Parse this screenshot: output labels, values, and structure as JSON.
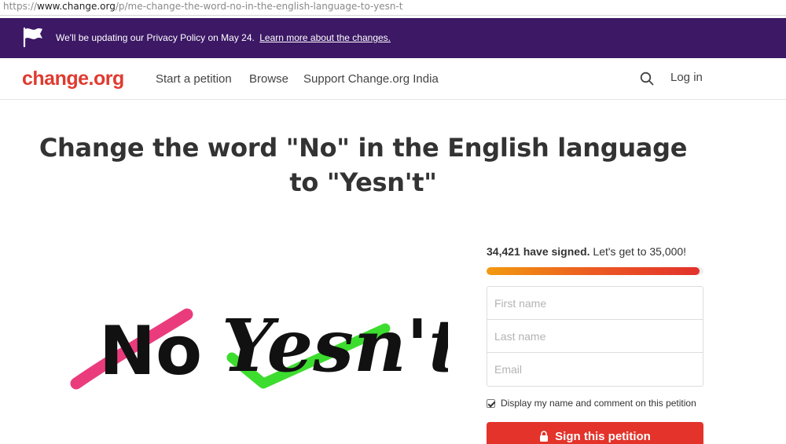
{
  "address_bar": {
    "scheme": "https://",
    "host": "www.change.org",
    "path": "/p/me-change-the-word-no-in-the-english-language-to-yesn-t"
  },
  "banner": {
    "icon": "flag-icon",
    "text": "We'll be updating our Privacy Policy on May 24.",
    "link": "Learn more about the changes.",
    "background": "#3c1865"
  },
  "nav": {
    "logo": "change.org",
    "links": [
      "Start a petition",
      "Browse",
      "Support Change.org India"
    ],
    "search_icon": "search-icon",
    "login": "Log in",
    "brand_color": "#e03a2f"
  },
  "petition": {
    "title": "Change the word \"No\" in the English language to \"Yesn't\"",
    "image": {
      "crossed_word": "No",
      "word": "Yesn't"
    }
  },
  "signatures": {
    "count": "34,421 have signed.",
    "goal": "Let's get to 35,000!",
    "progress_fraction": 0.983
  },
  "form": {
    "first_name_placeholder": "First name",
    "last_name_placeholder": "Last name",
    "email_placeholder": "Email",
    "display_label": "Display my name and comment on this petition",
    "display_checked": true,
    "submit": "Sign this petition",
    "submit_icon": "lock-icon",
    "submit_color": "#e3332a"
  }
}
